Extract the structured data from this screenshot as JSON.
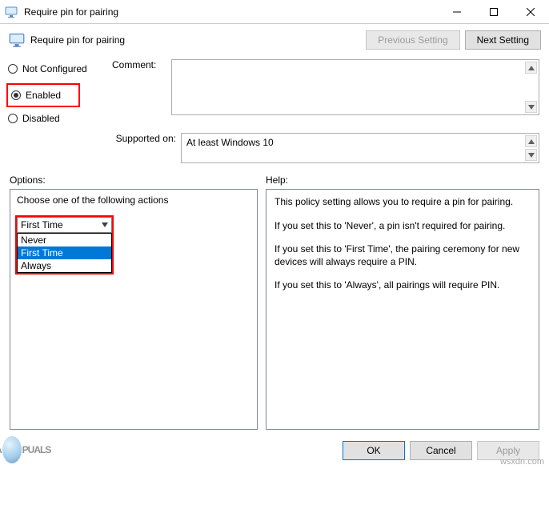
{
  "window": {
    "title": "Require pin for pairing"
  },
  "header": {
    "title": "Require pin for pairing",
    "previous_btn": "Previous Setting",
    "next_btn": "Next Setting"
  },
  "states": {
    "not_configured": "Not Configured",
    "enabled": "Enabled",
    "disabled": "Disabled",
    "selected": "enabled"
  },
  "comment": {
    "label": "Comment:",
    "value": ""
  },
  "supported": {
    "label": "Supported on:",
    "value": "At least Windows 10"
  },
  "sections": {
    "options_label": "Options:",
    "help_label": "Help:"
  },
  "options": {
    "heading": "Choose one of the following actions",
    "selected": "First Time",
    "items": [
      "Never",
      "First Time",
      "Always"
    ]
  },
  "help": {
    "p1": "This policy setting allows you to require a pin for pairing.",
    "p2": "If you set this to 'Never', a pin isn't required for pairing.",
    "p3": "If you set this to 'First Time', the pairing ceremony for new devices will always require a PIN.",
    "p4": "If you set this to 'Always', all pairings will require PIN."
  },
  "buttons": {
    "ok": "OK",
    "cancel": "Cancel",
    "apply": "Apply"
  },
  "watermark": {
    "left_a": "A",
    "left_puals": "PUALS",
    "right": "wsxdn.com"
  }
}
